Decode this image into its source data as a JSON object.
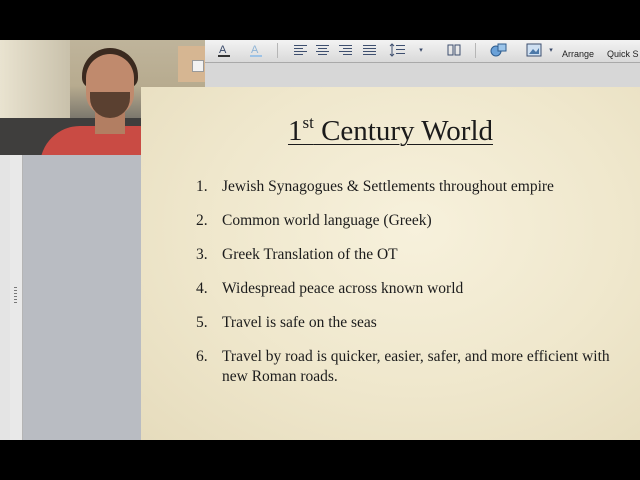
{
  "toolbar": {
    "arrange_label": "Arrange",
    "quick_styles_label": "Quick S"
  },
  "slide": {
    "title_prefix": "1",
    "title_super": "st",
    "title_rest": " Century World",
    "items": [
      {
        "num": "1.",
        "text": "Jewish Synagogues & Settlements throughout empire"
      },
      {
        "num": "2.",
        "text": "Common world language (Greek)"
      },
      {
        "num": "3.",
        "text": "Greek Translation of the OT"
      },
      {
        "num": "4.",
        "text": "Widespread peace across known world"
      },
      {
        "num": "5.",
        "text": "Travel is safe on the seas"
      },
      {
        "num": "6.",
        "text": "Travel by road is quicker, easier, safer, and more efficient with new Roman roads."
      }
    ]
  },
  "icons": [
    "font-color-icon",
    "text-highlight-icon",
    "align-left-icon",
    "align-center-icon",
    "align-right-icon",
    "justify-icon",
    "line-spacing-icon",
    "columns-icon",
    "shapes-icon",
    "picture-icon"
  ]
}
